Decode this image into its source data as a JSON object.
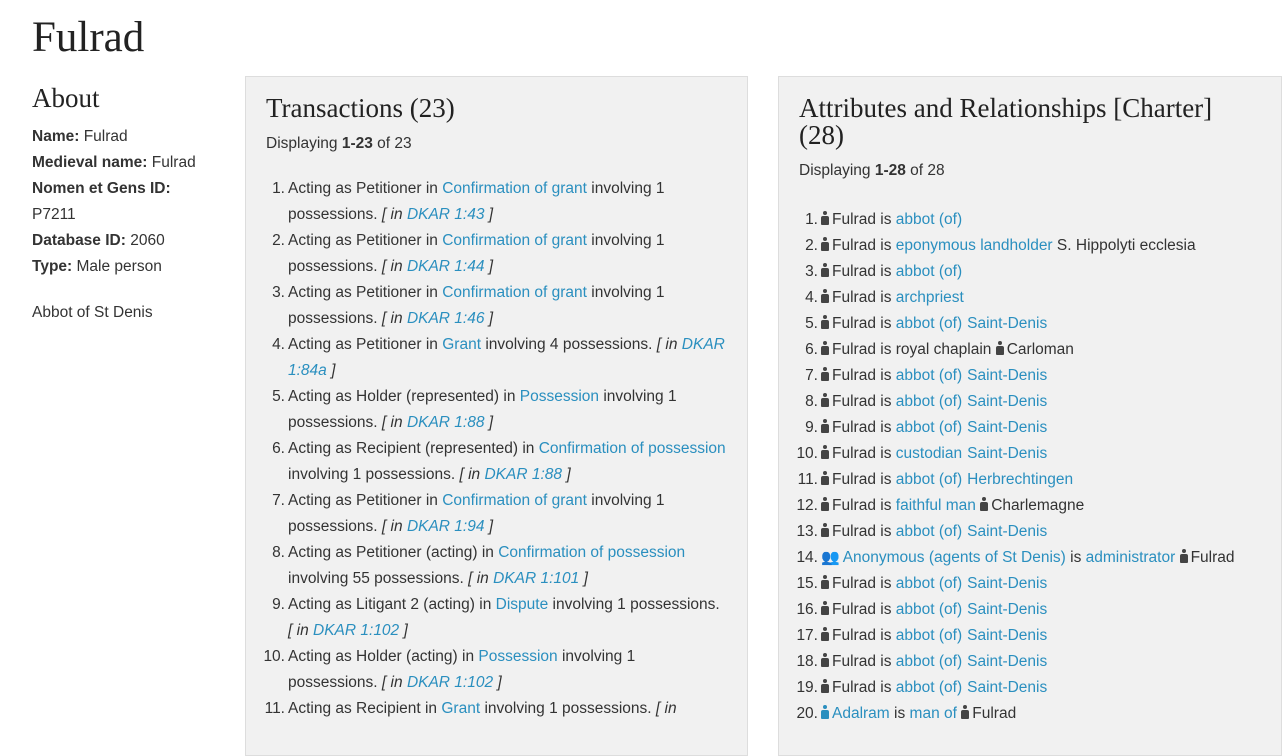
{
  "page": {
    "title": "Fulrad"
  },
  "about": {
    "heading": "About",
    "name_label": "Name:",
    "name_value": "Fulrad",
    "medieval_label": "Medieval name:",
    "medieval_value": "Fulrad",
    "nomen_label": "Nomen et Gens ID:",
    "nomen_value": "P7211",
    "db_label": "Database ID:",
    "db_value": "2060",
    "type_label": "Type:",
    "type_value": "Male person",
    "description": "Abbot of St Denis"
  },
  "transactions": {
    "heading": "Transactions (23)",
    "displaying_prefix": "Displaying",
    "displaying_range": "1-23",
    "displaying_suffix": "of 23",
    "items": [
      {
        "num": "1.",
        "role": "Acting as Petitioner in",
        "link": "Confirmation of grant",
        "post": "involving 1 possessions.",
        "ref": "DKAR 1:43"
      },
      {
        "num": "2.",
        "role": "Acting as Petitioner in",
        "link": "Confirmation of grant",
        "post": "involving 1 possessions.",
        "ref": "DKAR 1:44"
      },
      {
        "num": "3.",
        "role": "Acting as Petitioner in",
        "link": "Confirmation of grant",
        "post": "involving 1 possessions.",
        "ref": "DKAR 1:46"
      },
      {
        "num": "4.",
        "role": "Acting as Petitioner in",
        "link": "Grant",
        "post": "involving 4 possessions.",
        "ref": "DKAR 1:84a"
      },
      {
        "num": "5.",
        "role": "Acting as Holder (represented) in",
        "link": "Possession",
        "post": "involving 1 possessions.",
        "ref": "DKAR 1:88"
      },
      {
        "num": "6.",
        "role": "Acting as Recipient (represented) in",
        "link": "Confirmation of possession",
        "post": "involving 1 possessions.",
        "ref": "DKAR 1:88"
      },
      {
        "num": "7.",
        "role": "Acting as Petitioner in",
        "link": "Confirmation of grant",
        "post": "involving 1 possessions.",
        "ref": "DKAR 1:94"
      },
      {
        "num": "8.",
        "role": "Acting as Petitioner (acting) in",
        "link": "Confirmation of possession",
        "post": "involving 55 possessions.",
        "ref": "DKAR 1:101"
      },
      {
        "num": "9.",
        "role": "Acting as Litigant 2 (acting) in",
        "link": "Dispute",
        "post": "involving 1 possessions.",
        "ref": "DKAR 1:102"
      },
      {
        "num": "10.",
        "role": "Acting as Holder (acting) in",
        "link": "Possession",
        "post": "involving 1 possessions.",
        "ref": "DKAR 1:102"
      },
      {
        "num": "11.",
        "role": "Acting as Recipient in",
        "link": "Grant",
        "post": "involving 1 possessions.",
        "ref": ""
      }
    ],
    "ref_in": "in",
    "ref_open": "[",
    "ref_close": "]"
  },
  "attributes": {
    "heading": "Attributes and Relationships [Charter] (28)",
    "displaying_prefix": "Displaying",
    "displaying_range": "1-28",
    "displaying_suffix": "of 28",
    "is_word": "is",
    "items": [
      {
        "num": "1.",
        "subj": "Fulrad",
        "rel": "abbot (of)",
        "obj": "",
        "obj_type": ""
      },
      {
        "num": "2.",
        "subj": "Fulrad",
        "rel": "eponymous landholder",
        "obj": "S. Hippolyti ecclesia",
        "obj_type": "plain"
      },
      {
        "num": "3.",
        "subj": "Fulrad",
        "rel": "abbot (of)",
        "obj": "",
        "obj_type": ""
      },
      {
        "num": "4.",
        "subj": "Fulrad",
        "rel": "archpriest",
        "obj": "",
        "obj_type": ""
      },
      {
        "num": "5.",
        "subj": "Fulrad",
        "rel": "abbot (of)",
        "obj": "Saint-Denis",
        "obj_type": "link"
      },
      {
        "num": "6.",
        "subj": "Fulrad",
        "rel_plain": "royal chaplain",
        "obj": "Carloman",
        "obj_type": "person"
      },
      {
        "num": "7.",
        "subj": "Fulrad",
        "rel": "abbot (of)",
        "obj": "Saint-Denis",
        "obj_type": "link"
      },
      {
        "num": "8.",
        "subj": "Fulrad",
        "rel": "abbot (of)",
        "obj": "Saint-Denis",
        "obj_type": "link"
      },
      {
        "num": "9.",
        "subj": "Fulrad",
        "rel": "abbot (of)",
        "obj": "Saint-Denis",
        "obj_type": "link"
      },
      {
        "num": "10.",
        "subj": "Fulrad",
        "rel": "custodian",
        "obj": "Saint-Denis",
        "obj_type": "link"
      },
      {
        "num": "11.",
        "subj": "Fulrad",
        "rel": "abbot (of)",
        "obj": "Herbrechtingen",
        "obj_type": "link"
      },
      {
        "num": "12.",
        "subj": "Fulrad",
        "rel": "faithful man",
        "obj": "Charlemagne",
        "obj_type": "person"
      },
      {
        "num": "13.",
        "subj": "Fulrad",
        "rel": "abbot (of)",
        "obj": "Saint-Denis",
        "obj_type": "link"
      },
      {
        "num": "14.",
        "subj": "Anonymous (agents of St Denis)",
        "subj_type": "group",
        "rel": "administrator",
        "obj": "Fulrad",
        "obj_type": "person"
      },
      {
        "num": "15.",
        "subj": "Fulrad",
        "rel": "abbot (of)",
        "obj": "Saint-Denis",
        "obj_type": "link"
      },
      {
        "num": "16.",
        "subj": "Fulrad",
        "rel": "abbot (of)",
        "obj": "Saint-Denis",
        "obj_type": "link"
      },
      {
        "num": "17.",
        "subj": "Fulrad",
        "rel": "abbot (of)",
        "obj": "Saint-Denis",
        "obj_type": "link"
      },
      {
        "num": "18.",
        "subj": "Fulrad",
        "rel": "abbot (of)",
        "obj": "Saint-Denis",
        "obj_type": "link"
      },
      {
        "num": "19.",
        "subj": "Fulrad",
        "rel": "abbot (of)",
        "obj": "Saint-Denis",
        "obj_type": "link"
      },
      {
        "num": "20.",
        "subj": "Adalram",
        "subj_type": "link_person",
        "rel": "man of",
        "obj": "Fulrad",
        "obj_type": "person"
      }
    ]
  },
  "colors": {
    "link": "#2a8fbf",
    "panel_bg": "#f1f1f1",
    "panel_border": "#dddddd",
    "text": "#333333"
  },
  "icons": {
    "person": "person-icon",
    "group": "group-icon"
  }
}
